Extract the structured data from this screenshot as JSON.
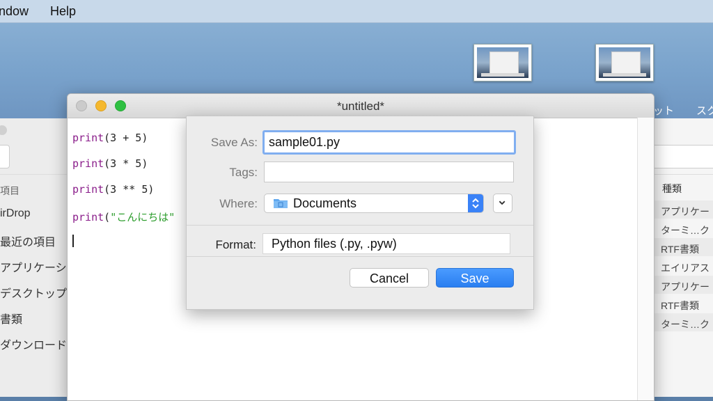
{
  "menubar": {
    "items": [
      "ndow",
      "Help"
    ]
  },
  "finder": {
    "sidebar_items": [
      "項目",
      "irDrop",
      "最近の項目",
      "アプリケーショ",
      "デスクトップ",
      "書類",
      "ダウンロード"
    ],
    "kind_header": "種類",
    "kind_values": [
      "アプリケー",
      "ターミ…ク",
      "RTF書類",
      "エイリアス",
      "アプリケー",
      "RTF書類",
      "ターミ…ク"
    ],
    "toolbar_text": [
      "ット",
      "スク"
    ]
  },
  "editor": {
    "title": "*untitled*",
    "code": [
      {
        "kw": "print",
        "rest": "(3 + 5)"
      },
      {
        "kw": "print",
        "rest": "(3 * 5)"
      },
      {
        "kw": "print",
        "rest": "(3 ** 5)"
      },
      {
        "kw": "print",
        "open": "(",
        "str": "\"こんにちは\""
      }
    ]
  },
  "save_dialog": {
    "save_as_label": "Save As:",
    "save_as_value": "sample01.py",
    "tags_label": "Tags:",
    "tags_value": "",
    "where_label": "Where:",
    "where_value": "Documents",
    "format_label": "Format:",
    "format_value": "Python files (.py, .pyw)",
    "cancel_label": "Cancel",
    "save_label": "Save"
  },
  "colors": {
    "accent": "#2a7ef0",
    "close": "#c8c8c8",
    "minimize": "#f5b82e",
    "zoom": "#2fc042"
  }
}
